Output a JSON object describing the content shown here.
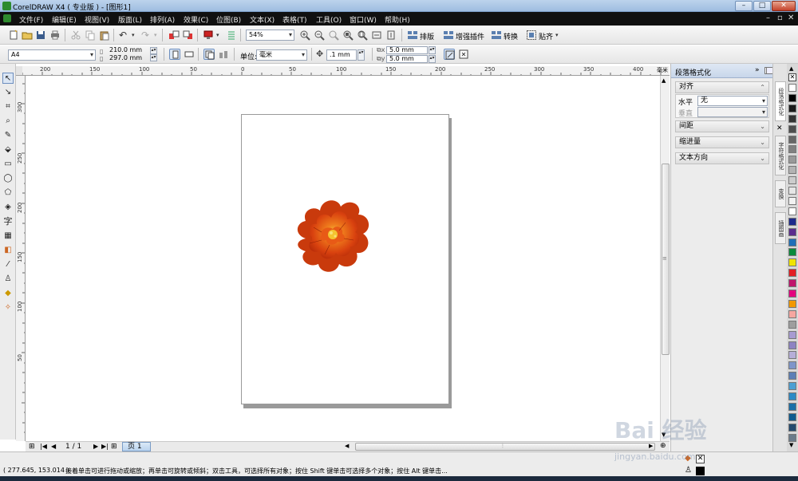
{
  "window": {
    "title": "CorelDRAW X4 ( 专业版 ) - [图形1]",
    "buttons": {
      "min": "–",
      "max": "□",
      "close": "✕"
    }
  },
  "menu": {
    "items": [
      "文件(F)",
      "编辑(E)",
      "视图(V)",
      "版面(L)",
      "排列(A)",
      "效果(C)",
      "位图(B)",
      "文本(X)",
      "表格(T)",
      "工具(O)",
      "窗口(W)",
      "帮助(H)"
    ],
    "doc_controls": {
      "min": "–",
      "max": "▫",
      "close": "✕"
    }
  },
  "standard_toolbar": {
    "zoom_value": "54%",
    "buttons": {
      "layout": "排版",
      "plugins": "增强插件",
      "convert": "转换",
      "snap": "贴齐"
    }
  },
  "property_bar": {
    "paper_size": "A4",
    "width": "210.0 mm",
    "height": "297.0 mm",
    "unit_label": "单位:",
    "unit_value": "毫米",
    "nudge": ".1 mm",
    "dup_x": "5.0 mm",
    "dup_y": "5.0 mm"
  },
  "rulers": {
    "horizontal": [
      "200",
      "150",
      "100",
      "50",
      "0",
      "50",
      "100",
      "150",
      "200",
      "250",
      "300",
      "350",
      "400"
    ],
    "vertical": [
      "300",
      "250",
      "200",
      "150",
      "100",
      "50"
    ],
    "unit": "毫米"
  },
  "page_nav": {
    "current": "1 / 1",
    "tab": "页 1"
  },
  "docker": {
    "title": "段落格式化",
    "sections": {
      "align": "对齐",
      "spacing": "间距",
      "indent": "缩进量",
      "direction": "文本方向"
    },
    "horizontal_label": "水平",
    "horizontal_value": "无",
    "vertical_label": "垂直"
  },
  "side_tabs": [
    "段落格式化",
    "字符格式化",
    "变换",
    "插图画"
  ],
  "palette": {
    "colors": [
      "#ffffff",
      "#000000",
      "#1a1a1a",
      "#333333",
      "#4d4d4d",
      "#666666",
      "#808080",
      "#999999",
      "#b3b3b3",
      "#cccccc",
      "#e6e6e6",
      "#f2f2f2",
      "#ffffff",
      "#1e2a8c",
      "#5b2d8e",
      "#1f6fb8",
      "#0b8a3b",
      "#f0e400",
      "#e31e24",
      "#c0156c",
      "#e4007f",
      "#f39800",
      "#f6a6a0",
      "#9e9e9e",
      "#a79bd1",
      "#8d83c2",
      "#b6aed8",
      "#7e95c9",
      "#5c7fb6",
      "#4d9fd3",
      "#2c8ac6",
      "#1a6fa8",
      "#0e5b8f",
      "#244a6e",
      "#6b7b8a"
    ]
  },
  "status": {
    "coords": "( 277.645, 153.014 )",
    "hint": "接着单击可进行拖动或缩放；再单击可旋转或倾斜；双击工具，可选择所有对象；按住 Shift 键单击可选择多个对象；按住 Alt 键单击..."
  },
  "watermark": {
    "brand": "Bai 经验",
    "url": "jingyan.baidu.com"
  }
}
